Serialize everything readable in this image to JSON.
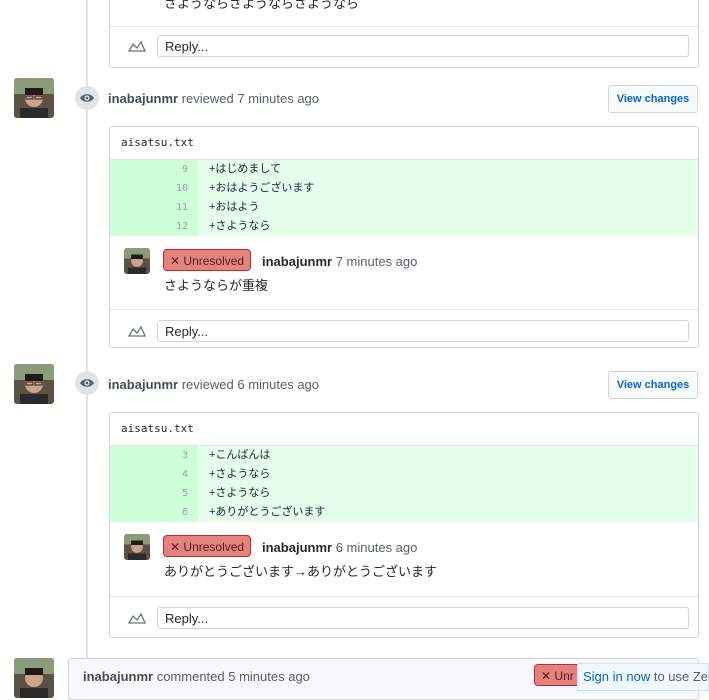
{
  "top_comment": {
    "body_fragment": "さようならさようならさようなら"
  },
  "reply_placeholder": "Reply...",
  "reviews": [
    {
      "author": "inabajunmr",
      "action": "reviewed",
      "time": "7 minutes ago",
      "view_button": "View changes",
      "file": "aisatsu.txt",
      "lines": [
        {
          "num": "9",
          "code": "+はじめまして"
        },
        {
          "num": "10",
          "code": "+おはようございます"
        },
        {
          "num": "11",
          "code": "+おはよう"
        },
        {
          "num": "12",
          "code": "+さようなら"
        }
      ],
      "comment": {
        "status": "Unresolved",
        "author": "inabajunmr",
        "time": "7 minutes ago",
        "body": "さようならが重複"
      }
    },
    {
      "author": "inabajunmr",
      "action": "reviewed",
      "time": "6 minutes ago",
      "view_button": "View changes",
      "file": "aisatsu.txt",
      "lines": [
        {
          "num": "3",
          "code": "+こんばんは"
        },
        {
          "num": "4",
          "code": "+さようなら"
        },
        {
          "num": "5",
          "code": "+さようなら"
        },
        {
          "num": "6",
          "code": "+ありがとうございます"
        }
      ],
      "comment": {
        "status": "Unresolved",
        "author": "inabajunmr",
        "time": "6 minutes ago",
        "body": "ありがとうございます→ありがとうございます"
      }
    }
  ],
  "bottom_comment": {
    "author": "inabajunmr",
    "action": "commented",
    "time": "5 minutes ago",
    "status_partial": "Unr"
  },
  "signin_bar": {
    "link": "Sign in now",
    "text": "to use Ze"
  },
  "colors": {
    "added_line_bg": "#e6ffed",
    "added_num_bg": "#cdffd8",
    "unresolved_bg": "#e3837f",
    "link": "#0366d6"
  },
  "icons": [
    "eye-icon",
    "reply-icon",
    "x-icon",
    "avatar"
  ]
}
